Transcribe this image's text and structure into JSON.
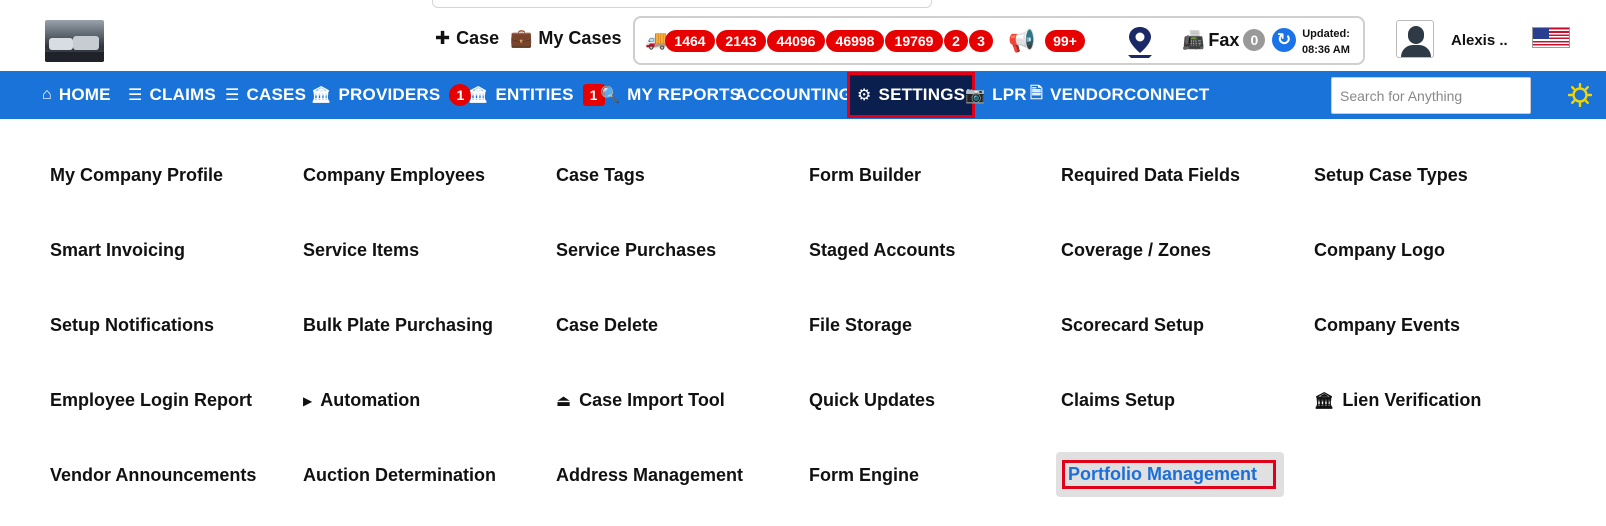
{
  "header": {
    "add_case_label": "Case",
    "my_cases_label": "My Cases",
    "counts": [
      "1464",
      "2143",
      "44096",
      "46998",
      "19769",
      "2",
      "3"
    ],
    "announcements_count": "99+",
    "fax_label": "Fax",
    "fax_count": "0",
    "updated_label": "Updated:",
    "updated_time": "08:36 AM",
    "username": "Alexis ..",
    "flag_icon": "us-flag-icon"
  },
  "nav": {
    "items": [
      {
        "label": "HOME",
        "icon": "home-icon"
      },
      {
        "label": "CLAIMS",
        "icon": "menu-icon"
      },
      {
        "label": "CASES",
        "icon": "menu-icon"
      },
      {
        "label": "PROVIDERS",
        "icon": "bank-icon",
        "badge": "1"
      },
      {
        "label": "ENTITIES",
        "icon": "bank-icon",
        "badge": "1"
      },
      {
        "label": "MY REPORTS",
        "icon": "search-icon"
      },
      {
        "label": "ACCOUNTING"
      },
      {
        "label": "SETTINGS",
        "icon": "gear-icon",
        "active": true
      },
      {
        "label": "LPR",
        "icon": "camera-icon"
      },
      {
        "label": "VENDORCONNECT",
        "icon": "file-icon"
      }
    ],
    "search_placeholder": "Search for Anything",
    "colors": {
      "nav_bg": "#1a73d9",
      "active_bg": "#0b1f4f",
      "badge": "#e60000",
      "highlight_text": "#1a6fd9"
    }
  },
  "settings_menu": {
    "rows": [
      [
        "My Company Profile",
        "Company Employees",
        "Case Tags",
        "Form Builder",
        "Required Data Fields",
        "Setup Case Types"
      ],
      [
        "Smart Invoicing",
        "Service Items",
        "Service Purchases",
        "Staged Accounts",
        "Coverage / Zones",
        "Company Logo"
      ],
      [
        "Setup Notifications",
        "Bulk Plate Purchasing",
        "Case Delete",
        "File Storage",
        "Scorecard Setup",
        "Company Events"
      ],
      [
        "Employee Login Report",
        "Automation",
        "Case Import Tool",
        "Quick Updates",
        "Claims Setup",
        "Lien Verification"
      ],
      [
        "Vendor Announcements",
        "Auction Determination",
        "Address Management",
        "Form Engine",
        "Portfolio Management"
      ]
    ]
  }
}
